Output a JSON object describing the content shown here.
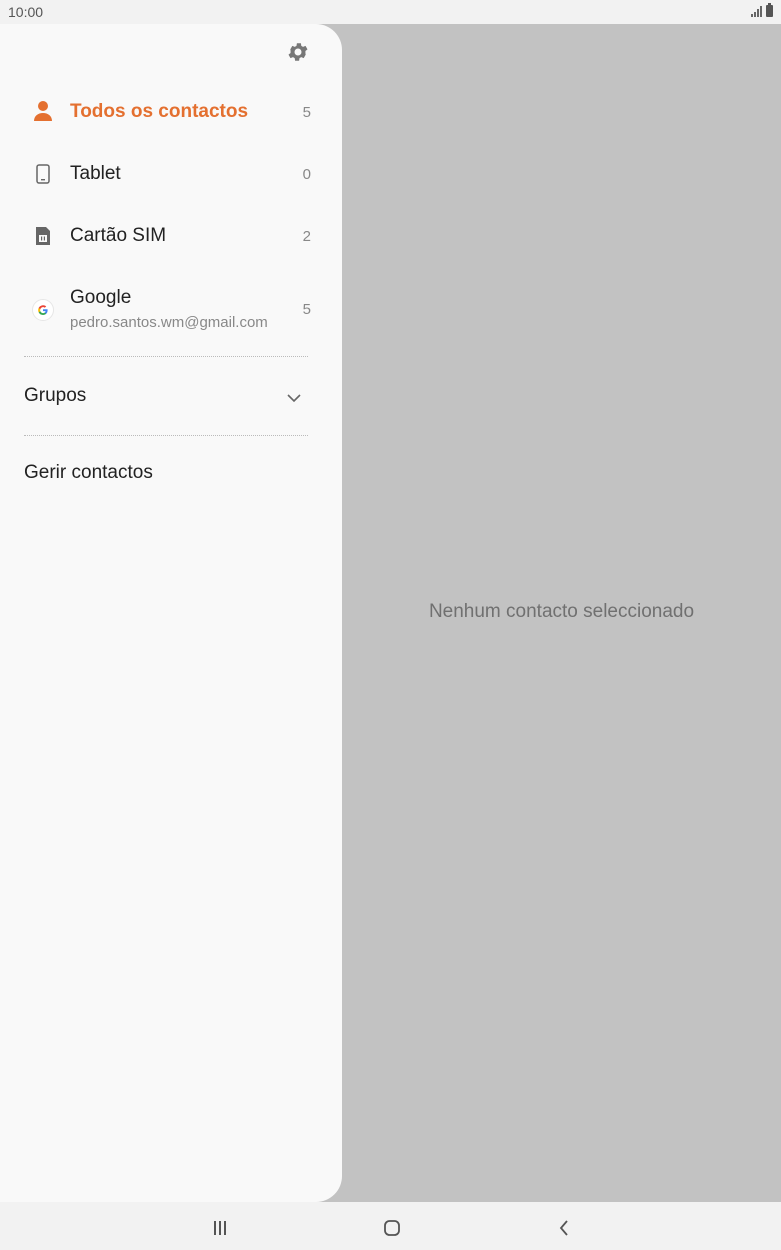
{
  "status_bar": {
    "time": "10:00"
  },
  "drawer": {
    "items": [
      {
        "label": "Todos os contactos",
        "count": "5",
        "icon": "person-icon",
        "active": true
      },
      {
        "label": "Tablet",
        "count": "0",
        "icon": "tablet-icon"
      },
      {
        "label": "Cartão SIM",
        "count": "2",
        "icon": "sim-card-icon"
      },
      {
        "label": "Google",
        "sub": "pedro.santos.wm@gmail.com",
        "count": "5",
        "icon": "google-icon"
      }
    ],
    "groups_label": "Grupos",
    "manage_label": "Gerir contactos"
  },
  "main": {
    "empty_message": "Nenhum contacto seleccionado"
  },
  "colors": {
    "accent": "#e47030",
    "drawer_bg": "#f9f9f9",
    "scrim": "#c2c2c2"
  }
}
